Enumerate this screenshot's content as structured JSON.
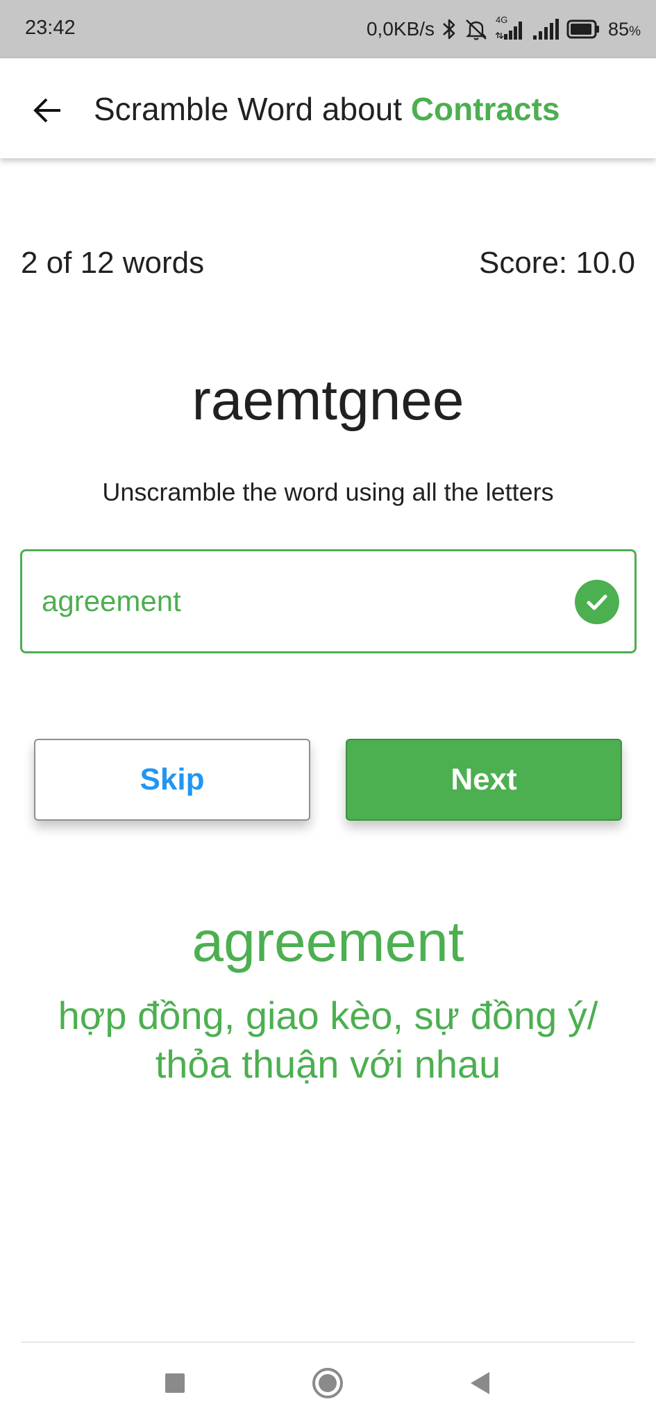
{
  "status_bar": {
    "time": "23:42",
    "net_speed": "0,0KB/s",
    "network_label": "4G",
    "battery_percent": "85",
    "battery_unit": "%"
  },
  "app_bar": {
    "title_prefix": "Scramble Word about ",
    "title_topic": "Contracts"
  },
  "game": {
    "progress": "2 of 12 words",
    "score": "Score: 10.0",
    "scrambled_word": "raemtgnee",
    "instruction": "Unscramble the word using all the letters",
    "answer_value": "agreement",
    "skip_label": "Skip",
    "next_label": "Next",
    "revealed_word": "agreement",
    "meaning_line1": "hợp đồng, giao kèo, sự đồng ý/",
    "meaning_line2": "thỏa thuận với nhau"
  },
  "colors": {
    "accent_green": "#4caf50",
    "skip_blue": "#2196f3",
    "status_bar_bg": "#c6c6c6"
  },
  "icons": [
    "bluetooth-icon",
    "mute-icon",
    "signal-icon",
    "battery-icon",
    "back-arrow-icon",
    "check-circle-icon",
    "recents-square-icon",
    "home-circle-icon",
    "back-triangle-icon"
  ]
}
